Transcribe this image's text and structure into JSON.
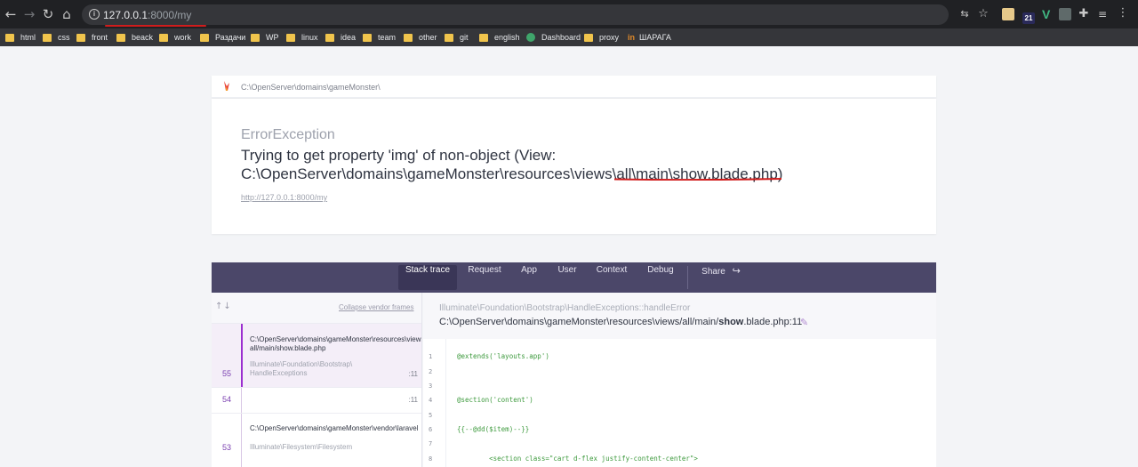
{
  "browser": {
    "url_host": "127.0.0.1",
    "url_path": ":8000/my",
    "bookmarks": [
      {
        "label": "html"
      },
      {
        "label": "css"
      },
      {
        "label": "front"
      },
      {
        "label": "beack"
      },
      {
        "label": "work"
      },
      {
        "label": "Раздачи"
      },
      {
        "label": "WP"
      },
      {
        "label": "linux"
      },
      {
        "label": "idea"
      },
      {
        "label": "team"
      },
      {
        "label": "other"
      },
      {
        "label": "git"
      },
      {
        "label": "english"
      },
      {
        "label": "Dashboard"
      },
      {
        "label": "proxy"
      },
      {
        "label": "ШАРАГА"
      }
    ],
    "ext_badge": "21",
    "ext_v": "V"
  },
  "error": {
    "root_path": "C:\\OpenServer\\domains\\gameMonster\\",
    "exception_class": "ErrorException",
    "message_line1": "Trying to get property 'img' of non-object (View:",
    "message_line2": "C:\\OpenServer\\domains\\gameMonster\\resources\\views\\all\\main\\show.blade.php)",
    "url": "http://127.0.0.1:8000/my"
  },
  "tabs": [
    {
      "label": "Stack trace"
    },
    {
      "label": "Request"
    },
    {
      "label": "App"
    },
    {
      "label": "User"
    },
    {
      "label": "Context"
    },
    {
      "label": "Debug"
    },
    {
      "label": "Share"
    }
  ],
  "stack": {
    "collapse_label": "Collapse vendor frames",
    "frames": [
      {
        "num": "55",
        "file1": "C:\\OpenServer\\domains\\gameMonster\\resources\\views\\",
        "file2": "all/main/show.blade.php",
        "cls1": "Illuminate\\Foundation\\Bootstrap\\",
        "cls2": "HandleExceptions",
        "line": ":11"
      },
      {
        "num": "54",
        "line": ":11"
      },
      {
        "num": "53",
        "file1": "C:\\OpenServer\\domains\\gameMonster\\vendor\\laravel",
        "cls1": "Illuminate\\Filesystem\\Filesystem"
      }
    ]
  },
  "code": {
    "class_path": "Illuminate\\Foundation\\Bootstrap\\HandleExceptions::handleError",
    "file_prefix": "C:\\OpenServer\\domains\\gameMonster\\resources\\views/all/main/",
    "file_bold": "show",
    "file_suffix": ".blade.php:11",
    "lines": [
      {
        "n": "1",
        "text": "@extends('layouts.app')"
      },
      {
        "n": "2",
        "text": ""
      },
      {
        "n": "3",
        "text": ""
      },
      {
        "n": "4",
        "text": "@section('content')"
      },
      {
        "n": "5",
        "text": ""
      },
      {
        "n": "6",
        "text": "{{--@dd($item)--}}"
      },
      {
        "n": "7",
        "text": ""
      },
      {
        "n": "8",
        "text": "        <section class=\"cart d-flex justify-content-center\">"
      }
    ]
  },
  "colors": {
    "accent": "#9b2ecf",
    "tabbar": "#4b4769",
    "annotation": "#d01c1c"
  }
}
